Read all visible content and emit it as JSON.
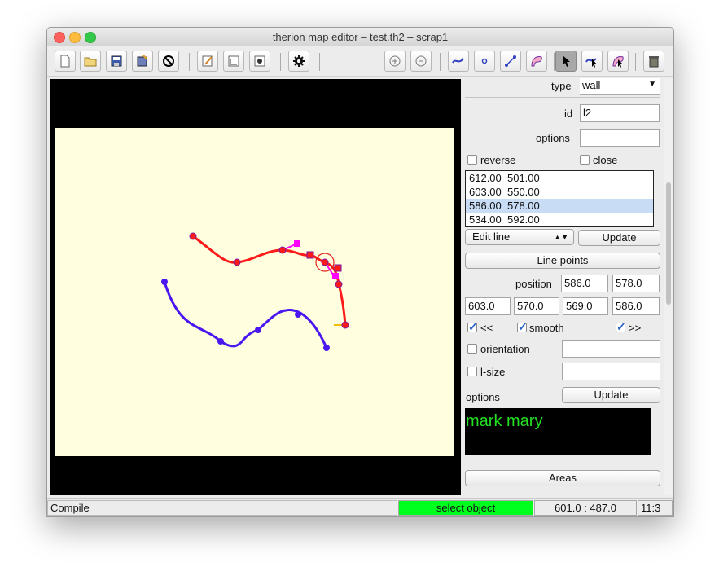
{
  "window": {
    "title": "therion map editor – test.th2 – scrap1"
  },
  "toolbar": {
    "icons": [
      "new-file-icon",
      "open-folder-icon",
      "save-icon",
      "save-as-icon",
      "close-icon",
      "edit-icon",
      "image-icon",
      "settings-icon",
      "compile-gear-icon",
      "zoom-in-icon",
      "zoom-out-icon",
      "insert-line-icon",
      "insert-point-icon",
      "insert-line-segment-icon",
      "insert-area-icon",
      "select-arrow-icon",
      "select-line-icon",
      "select-area-icon",
      "trash-icon"
    ],
    "selected": "select-arrow-icon"
  },
  "panel": {
    "type_label": "type",
    "type_value": "wall",
    "id_label": "id",
    "id_value": "l2",
    "options_label": "options",
    "options_value": "",
    "reverse_label": "reverse",
    "close_label": "close",
    "coords": [
      "612.00  501.00",
      "603.00  550.00",
      "586.00  578.00",
      "534.00  592.00"
    ],
    "selected_coord_index": 2,
    "edit_mode": "Edit line",
    "update_label": "Update",
    "line_points_label": "Line points",
    "position_label": "position",
    "position_x": "586.0",
    "position_y": "578.0",
    "cp1_x": "603.0",
    "cp1_y": "570.0",
    "cp2_x": "569.0",
    "cp2_y": "586.0",
    "prev_label": "<<",
    "smooth_label": "smooth",
    "next_label": ">>",
    "orientation_label": "orientation",
    "lsize_label": "l-size",
    "options2_label": "options",
    "update2_label": "Update",
    "console_text": "mark mary",
    "areas_label": "Areas"
  },
  "status": {
    "compile": "Compile",
    "mode": "select object",
    "coords": "601.0 : 487.0",
    "zoom": "11:3"
  },
  "colors": {
    "mode_bg": "#00ff1e",
    "selected_line": "#ff1a1a",
    "other_line": "#4a17f0",
    "control_point": "#ff00ff"
  }
}
